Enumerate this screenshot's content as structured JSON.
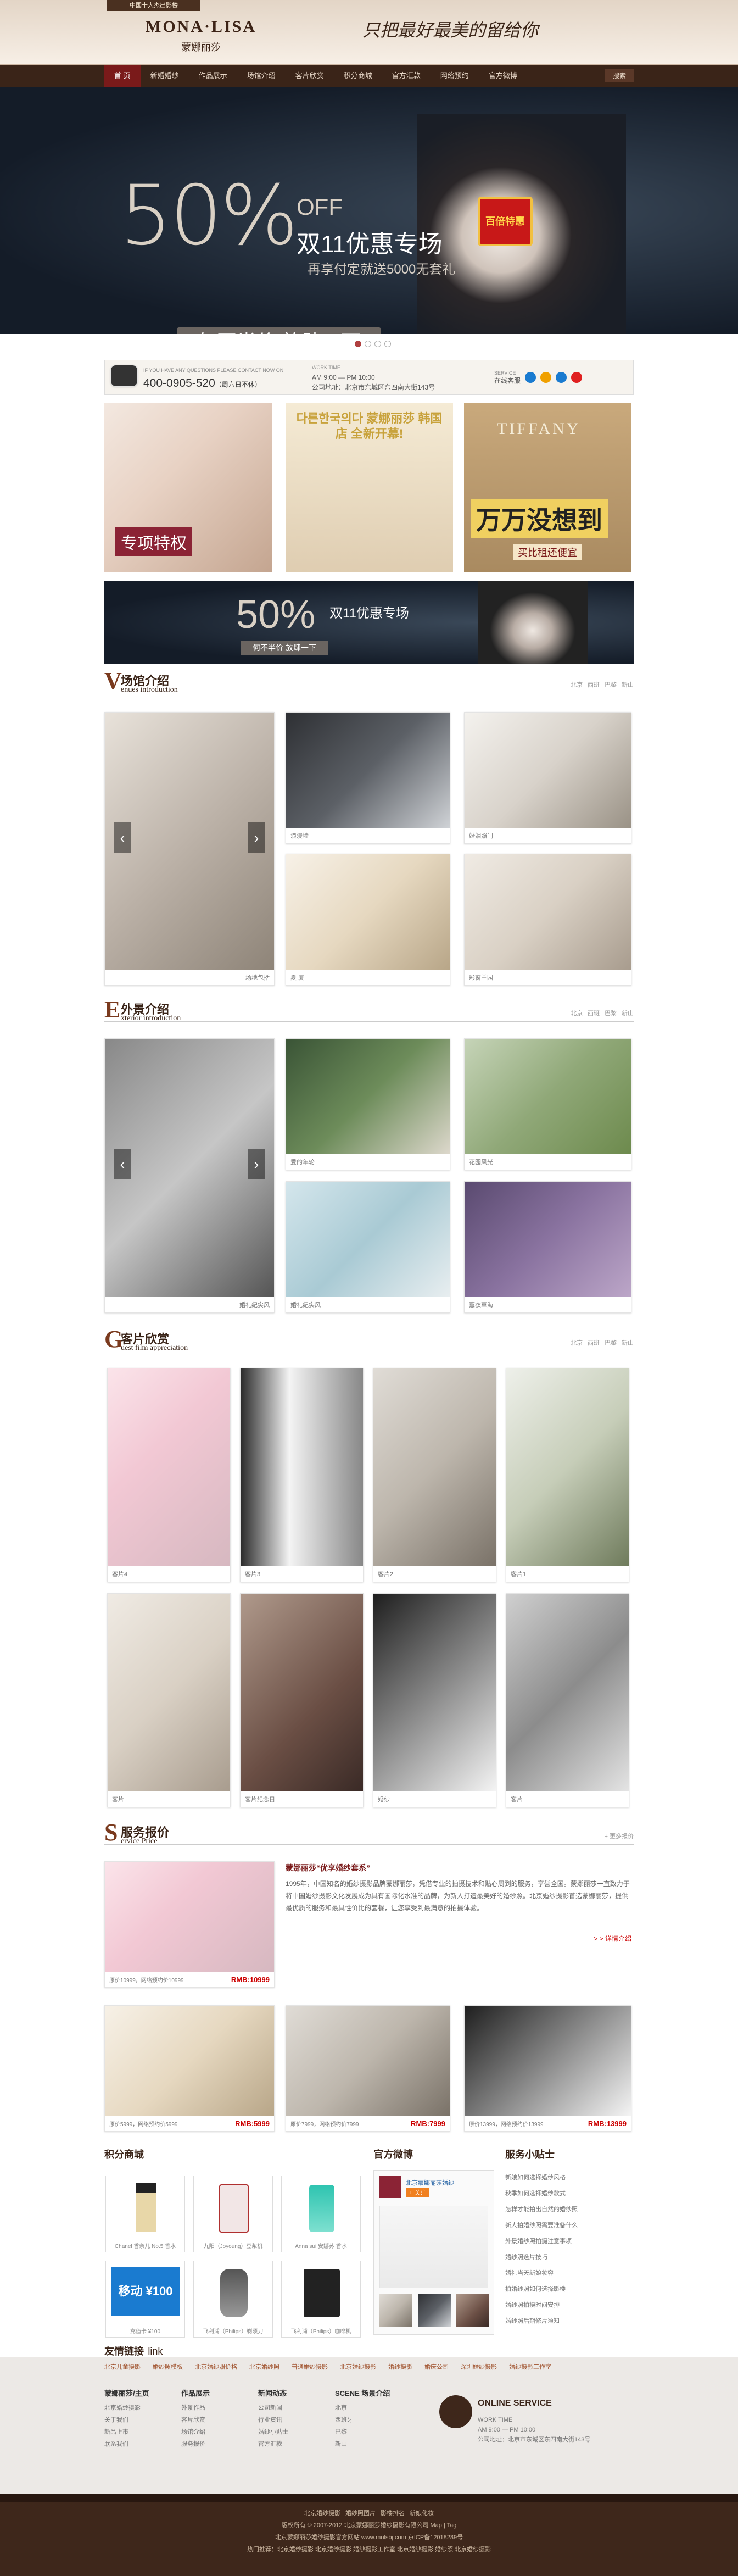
{
  "header": {
    "logo_top": "中国十大杰出影楼",
    "logo": "MONA·LISA",
    "logo_cn": "蒙娜丽莎",
    "slogan": "只把最好最美的留给你"
  },
  "nav": {
    "items": [
      "首 页",
      "新婚婚纱",
      "作品展示",
      "场馆介绍",
      "客片欣赏",
      "积分商城",
      "官方汇款",
      "网络预约",
      "官方微博"
    ],
    "right": "搜索"
  },
  "banner": {
    "pct": "50%",
    "off": "OFF",
    "title": "双11优惠专场",
    "subtitle": "再享付定就送5000无套礼",
    "button": "何不半价 放肆一下",
    "gift": "百倍特惠"
  },
  "info": {
    "phone_label": "IF YOU HAVE ANY QUESTIONS PLEASE CONTACT NOW ON",
    "phone": "400-0905-520",
    "phone_note": "（周六日不休）",
    "time_label": "WORK TIME",
    "time": "AM 9:00 — PM 10:00",
    "address": "公司地址：北京市东城区东四南大街143号",
    "serv_label": "SERVICE",
    "serv": "在线客服"
  },
  "promos": [
    {
      "label": "专项特权"
    },
    {
      "label": "다른한국의다 蒙娜丽莎 韩国店 全新开幕!"
    },
    {
      "label": "TIFFANY",
      "big": "万万没想到",
      "small": "买比租还便宜"
    }
  ],
  "strip": {
    "pct": "50%",
    "title": "双11优惠专场",
    "button": "何不半价 放肆一下"
  },
  "venues": {
    "big": "V",
    "cn": "场馆介绍",
    "en": "enues introduction",
    "links": "北京 | 西班 | 巴黎 | 新山",
    "main": "场地包括",
    "items": [
      "浪漫墙",
      "婚姻照门",
      "夏 厦",
      "彩窗兰园"
    ]
  },
  "exterior": {
    "big": "E",
    "cn": "外景介绍",
    "en": "xterior introduction",
    "links": "北京 | 西班 | 巴黎 | 新山",
    "main": "婚礼纪实风",
    "items": [
      "爱的年轮",
      "花园风光",
      "婚礼纪实风",
      "薰衣草海"
    ]
  },
  "guest": {
    "big": "G",
    "cn": "客片欣赏",
    "en": "uest film appreciation",
    "links": "北京 | 西班 | 巴黎 | 新山",
    "items": [
      "客片4",
      "客片3",
      "客片2",
      "客片1",
      "客片",
      "客片纪念日",
      "婚纱",
      "客片"
    ]
  },
  "service": {
    "big": "S",
    "cn": "服务报价",
    "en": "ervice Price",
    "more": "+ 更多报价",
    "title": "蒙娜丽莎“优享婚纱套系”",
    "text": "1995年，中国知名的婚纱摄影品牌蒙娜丽莎，凭借专业的拍摄技术和贴心周到的服务，享誉全国。蒙娜丽莎一直致力于将中国婚纱摄影文化发展成为具有国际化水准的品牌，为新人打造最美好的婚纱照。北京婚纱摄影首选蒙娜丽莎，提供最优质的服务和最具性价比的套餐，让您享受到最满意的拍摄体验。",
    "detail": "> > 详情介绍",
    "main_price": "RMB:10999",
    "main_note": "原价10999，网络预约价10999",
    "items": [
      {
        "price": "RMB:5999",
        "note": "原价5999，网络预约价5999"
      },
      {
        "price": "RMB:7999",
        "note": "原价7999，网络预约价7999"
      },
      {
        "price": "RMB:13999",
        "note": "原价13999，网络预约价13999"
      }
    ]
  },
  "shop": {
    "title": "积分商城",
    "items": [
      "Chanel 香奈儿 No.5 香水",
      "九阳（Joyoung）豆浆机",
      "Anna sui 安娜苏 香水",
      "充值卡 ¥100",
      "飞利浦（Philips）剃须刀",
      "飞利浦（Philips）咖啡机"
    ],
    "recharge": "移动 ¥100"
  },
  "weibo": {
    "title": "官方微博",
    "name": "北京蒙娜丽莎婚纱",
    "follow": "+ 关注"
  },
  "tips": {
    "title": "服务小贴士",
    "items": [
      "新娘如何选择婚纱风格",
      "秋季如何选择婚纱款式",
      "怎样才能拍出自然的婚纱照",
      "新人拍婚纱照需要准备什么",
      "外景婚纱照拍摄注意事项",
      "婚纱照选片技巧",
      "婚礼当天新娘妆容",
      "拍婚纱照如何选择影楼",
      "婚纱照拍摄时间安排",
      "婚纱照后期修片须知",
      "婚纱照服装搭配技巧"
    ]
  },
  "links": {
    "title": "友情链接",
    "en": "link",
    "items": [
      "北京儿童摄影",
      "婚纱照模板",
      "北京婚纱照价格",
      "北京婚纱照",
      "普通婚纱摄影",
      "北京婚纱摄影",
      "婚纱摄影",
      "婚庆公司",
      "深圳婚纱摄影",
      "婚纱摄影工作室"
    ]
  },
  "footer": {
    "cols": [
      {
        "title": "蒙娜丽莎/主页",
        "items": [
          "北京婚纱摄影",
          "关于我们",
          "新品上市",
          "联系我们"
        ]
      },
      {
        "title": "作品展示",
        "items": [
          "外景作品",
          "客片欣赏",
          "场馆介绍",
          "服务报价"
        ]
      },
      {
        "title": "新闻动态",
        "items": [
          "公司新闻",
          "行业资讯",
          "婚纱小贴士",
          "官方汇款"
        ]
      },
      {
        "title": "SCENE 场景介绍",
        "items": [
          "北京",
          "西班牙",
          "巴黎",
          "新山"
        ]
      }
    ],
    "online": "ONLINE SERVICE",
    "time_label": "WORK TIME",
    "time": "AM 9:00 — PM 10:00",
    "address": "公司地址：北京市东城区东四南大街143号"
  },
  "bottom": {
    "line1": "北京婚纱摄影 | 婚纱照图片 | 影楼排名 | 新娘化妆",
    "line2": "版权所有 © 2007-2012 北京蒙娜丽莎婚纱摄影有限公司 Map | Tag",
    "line3": "北京蒙娜丽莎婚纱摄影官方网站 www.mnlsbj.com 京ICP备12018289号",
    "line4": "热门推荐：北京婚纱摄影 北京婚纱摄影 婚纱摄影工作室 北京婚纱摄影 婚纱照 北京婚纱摄影"
  }
}
